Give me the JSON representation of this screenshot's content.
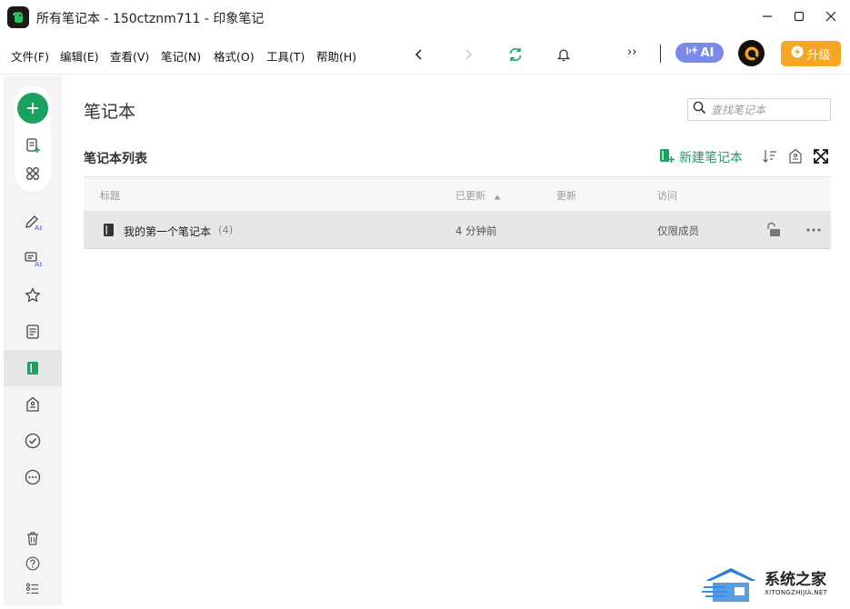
{
  "window": {
    "title": "所有笔记本 - 150ctznm711 - 印象笔记",
    "icons": {
      "app": "evernote-elephant-icon",
      "minimize": "minimize-icon",
      "maximize": "maximize-icon",
      "close": "close-icon"
    }
  },
  "menu": {
    "file": "文件(F)",
    "edit": "编辑(E)",
    "view": "查看(V)",
    "note": "笔记(N)",
    "format": "格式(O)",
    "tools": "工具(T)",
    "help": "帮助(H)"
  },
  "toolbar": {
    "ai_label": "AI",
    "overflow_label": "››",
    "upgrade_label": "升级",
    "icons": [
      "back-arrow-icon",
      "forward-arrow-icon",
      "sync-icon",
      "bell-icon",
      "ai-sparkle-icon",
      "avatar-icon",
      "lightning-icon"
    ]
  },
  "sidebar": {
    "icons": [
      "plus-icon",
      "new-note-icon",
      "apps-grid-icon",
      "ai-pen-icon",
      "ai-chat-icon",
      "star-icon",
      "notes-icon",
      "notebook-icon",
      "tag-icon",
      "check-circle-icon",
      "more-icon",
      "trash-icon",
      "help-icon",
      "checklist-icon"
    ],
    "active": "notebook-icon"
  },
  "main": {
    "title": "笔记本",
    "search_placeholder": "查找笔记本",
    "list_title": "笔记本列表",
    "new_notebook_label": "新建笔记本",
    "table": {
      "columns": [
        "标题",
        "已更新",
        "更新",
        "访问"
      ],
      "sorted_column": "已更新",
      "rows": [
        {
          "name": "我的第一个笔记本",
          "count": "(4)",
          "updated": "4 分钟前",
          "updated_by": "",
          "access": "仅限成员"
        }
      ]
    }
  },
  "watermark": {
    "cn": "系统之家",
    "en": "XITONGZHIJIA.NET"
  },
  "colors": {
    "accent_green": "#1aa260",
    "ai_purple": "#7b8ae8",
    "upgrade_orange": "#f5a623"
  }
}
